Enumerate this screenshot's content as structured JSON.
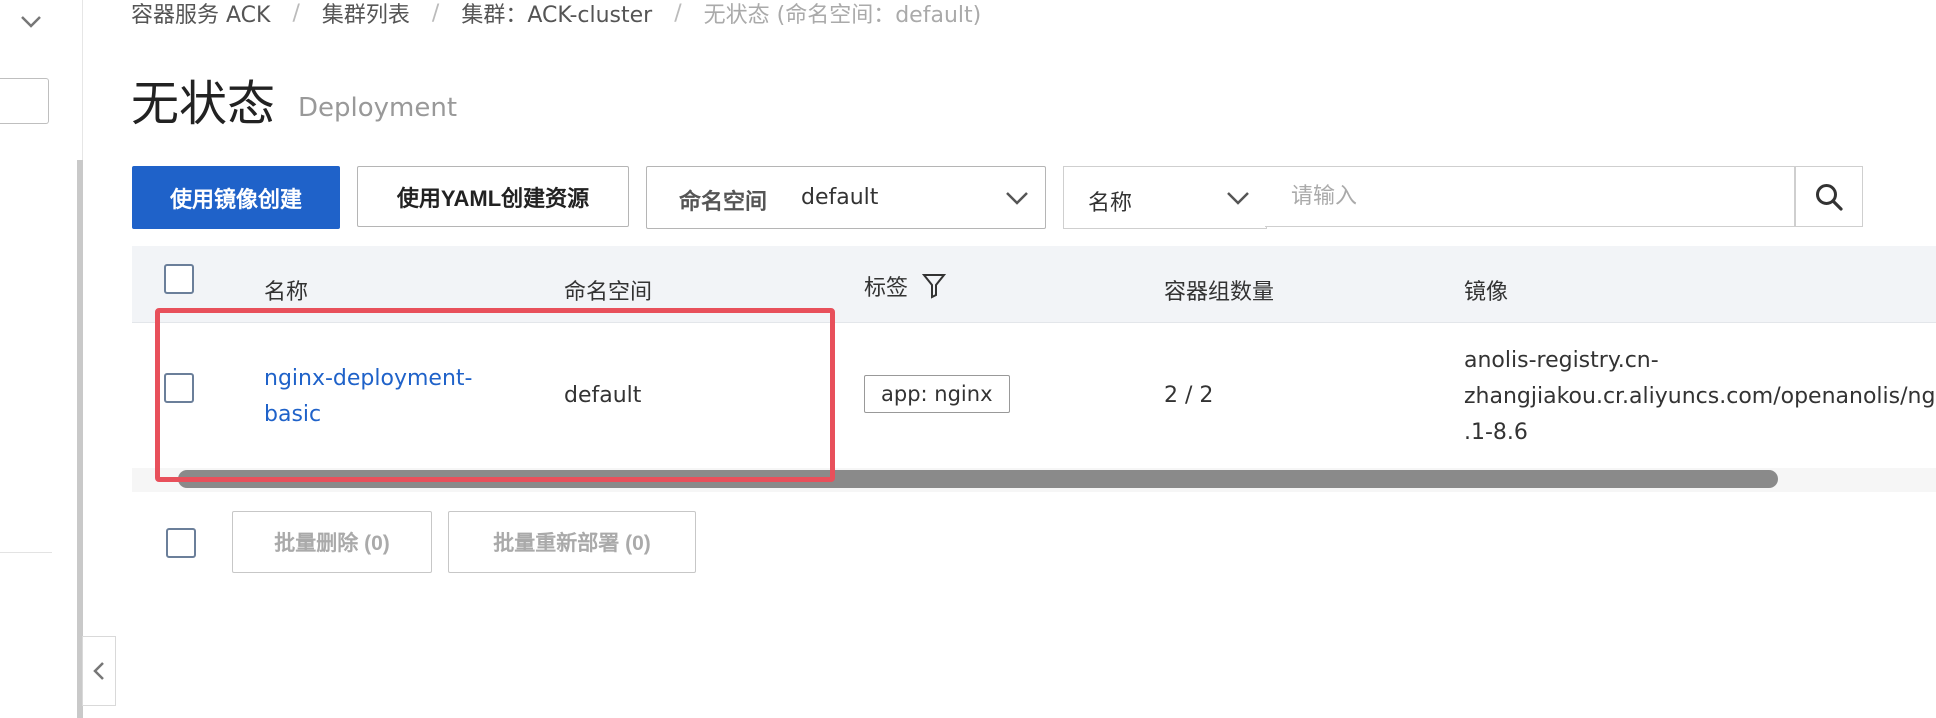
{
  "breadcrumb": {
    "items": [
      "容器服务 ACK",
      "集群列表",
      "集群：ACK-cluster"
    ],
    "current": "无状态 (命名空间：default)"
  },
  "page": {
    "title": "无状态",
    "subtitle": "Deployment"
  },
  "toolbar": {
    "create_image_label": "使用镜像创建",
    "create_yaml_label": "使用YAML创建资源",
    "namespace_label": "命名空间",
    "namespace_value": "default",
    "search_field": "名称",
    "search_placeholder": "请输入"
  },
  "table": {
    "columns": [
      "名称",
      "命名空间",
      "标签",
      "容器组数量",
      "镜像"
    ],
    "rows": [
      {
        "name_line1": "nginx-deployment-",
        "name_line2": "basic",
        "namespace": "default",
        "label": "app: nginx",
        "pods": "2 / 2",
        "image_line1": "anolis-registry.cn-",
        "image_line2": "zhangjiakou.cr.aliyuncs.com/openanolis/ngin",
        "image_line3": ".1-8.6"
      }
    ]
  },
  "batch": {
    "delete_label": "批量删除 (0)",
    "redeploy_label": "批量重新部署 (0)"
  },
  "colors": {
    "primary": "#1f62c9",
    "highlight": "#e8505b"
  }
}
